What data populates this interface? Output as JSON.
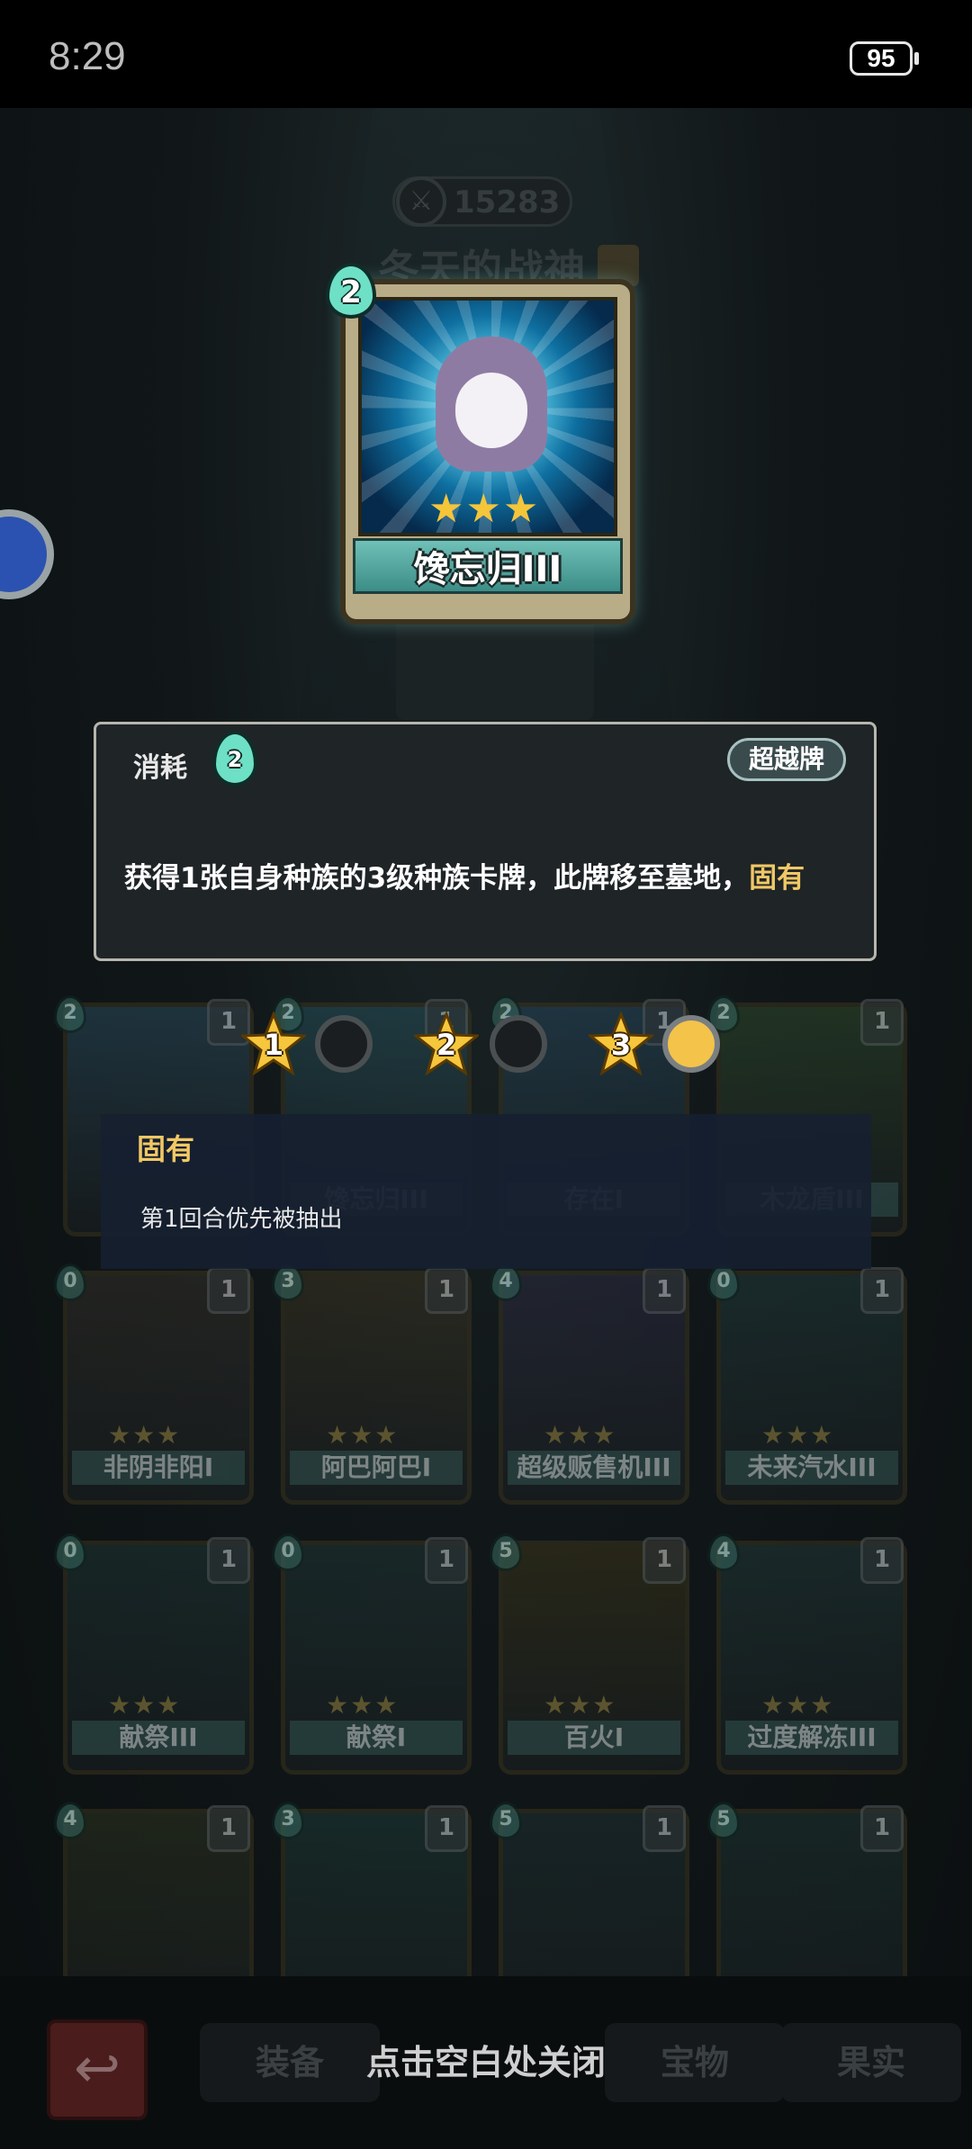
{
  "status_bar": {
    "time": "8:29",
    "battery": "95"
  },
  "hero": {
    "score": "15283",
    "name": "冬天的战神"
  },
  "featured_card": {
    "name": "馋忘归III",
    "cost": "2",
    "stars": 3
  },
  "info_panel": {
    "consume_label": "消耗",
    "cost": "2",
    "tag": "超越牌",
    "description": "获得1张自身种族的3级种族卡牌，此牌移至墓地，",
    "keyword": "固有"
  },
  "level_selector": {
    "levels": [
      "1",
      "2",
      "3"
    ],
    "selected_level": "3"
  },
  "keyword_tooltip": {
    "title": "固有",
    "description": "第1回合优先被抽出"
  },
  "deck": {
    "rows": [
      [
        {
          "name": "",
          "cost": "2",
          "count": "1",
          "stars": "",
          "color": "#2b4b5c"
        },
        {
          "name": "馋忘归III",
          "cost": "2",
          "count": "1",
          "stars": "",
          "color": "#25505a"
        },
        {
          "name": "存在I",
          "cost": "2",
          "count": "1",
          "stars": "",
          "color": "#25465a"
        },
        {
          "name": "木龙盾III",
          "cost": "2",
          "count": "1",
          "stars": "",
          "color": "#2f4a2c"
        }
      ],
      [
        {
          "name": "非阴非阳I",
          "cost": "0",
          "count": "1",
          "stars": "★★★",
          "color": "#33302a"
        },
        {
          "name": "阿巴阿巴I",
          "cost": "3",
          "count": "1",
          "stars": "★★★",
          "color": "#3a3422"
        },
        {
          "name": "超级贩售机III",
          "cost": "4",
          "count": "1",
          "stars": "★★★",
          "color": "#2c2c40"
        },
        {
          "name": "未来汽水III",
          "cost": "0",
          "count": "1",
          "stars": "★★★",
          "color": "#223a3a"
        }
      ],
      [
        {
          "name": "献祭III",
          "cost": "0",
          "count": "1",
          "stars": "★★★",
          "color": "#1f3534"
        },
        {
          "name": "献祭I",
          "cost": "0",
          "count": "1",
          "stars": "★★★",
          "color": "#1f3534"
        },
        {
          "name": "百火I",
          "cost": "5",
          "count": "1",
          "stars": "★★★",
          "color": "#3a3418"
        },
        {
          "name": "过度解冻III",
          "cost": "4",
          "count": "1",
          "stars": "★★★",
          "color": "#223838"
        }
      ],
      [
        {
          "name": "",
          "cost": "4",
          "count": "1",
          "stars": "",
          "color": "#2d3420"
        },
        {
          "name": "",
          "cost": "3",
          "count": "1",
          "stars": "",
          "color": "#1d3a36"
        },
        {
          "name": "",
          "cost": "5",
          "count": "1",
          "stars": "",
          "color": "#1e3032"
        },
        {
          "name": "",
          "cost": "5",
          "count": "1",
          "stars": "",
          "color": "#1e3432"
        }
      ]
    ]
  },
  "bottom_bar": {
    "tabs": [
      "装备",
      "宝物",
      "果实"
    ],
    "close_hint": "点击空白处关闭"
  },
  "colors": {
    "keyword": "#f0c865",
    "accent_teal": "#6ee0c6",
    "selected_dot": "#f4c34a"
  }
}
